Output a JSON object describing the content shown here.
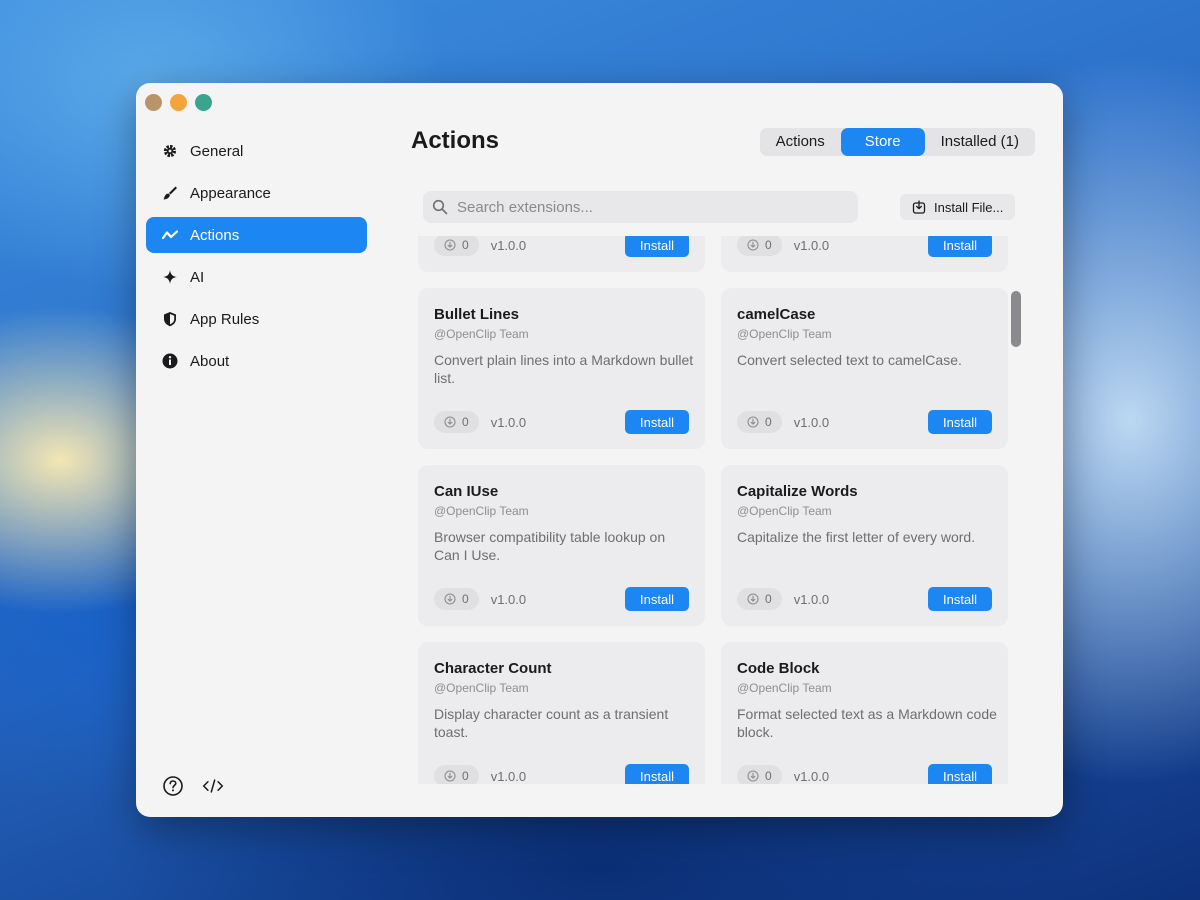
{
  "window": {
    "title": "Actions"
  },
  "sidebar": {
    "items": [
      {
        "label": "General",
        "icon": "gear-icon",
        "active": false
      },
      {
        "label": "Appearance",
        "icon": "brush-icon",
        "active": false
      },
      {
        "label": "Actions",
        "icon": "wave-icon",
        "active": true
      },
      {
        "label": "AI",
        "icon": "sparkle-icon",
        "active": false
      },
      {
        "label": "App Rules",
        "icon": "shield-icon",
        "active": false
      },
      {
        "label": "About",
        "icon": "info-icon",
        "active": false
      }
    ],
    "bottom_icons": [
      "help-icon",
      "code-icon"
    ]
  },
  "tabs": [
    {
      "label": "Actions",
      "active": false
    },
    {
      "label": "Store",
      "active": true
    },
    {
      "label": "Installed (1)",
      "active": false
    }
  ],
  "search": {
    "placeholder": "Search extensions...",
    "value": ""
  },
  "install_file_label": "Install File...",
  "cards": [
    {
      "title": "",
      "author": "",
      "description": "",
      "downloads": "0",
      "version": "v1.0.0",
      "button": "Install"
    },
    {
      "title": "",
      "author": "",
      "description": "",
      "downloads": "0",
      "version": "v1.0.0",
      "button": "Install"
    },
    {
      "title": "Bullet Lines",
      "author": "@OpenClip Team",
      "description": "Convert plain lines into a Markdown bullet list.",
      "downloads": "0",
      "version": "v1.0.0",
      "button": "Install"
    },
    {
      "title": "camelCase",
      "author": "@OpenClip Team",
      "description": "Convert selected text to camelCase.",
      "downloads": "0",
      "version": "v1.0.0",
      "button": "Install"
    },
    {
      "title": "Can IUse",
      "author": "@OpenClip Team",
      "description": "Browser compatibility table lookup on Can I Use.",
      "downloads": "0",
      "version": "v1.0.0",
      "button": "Install"
    },
    {
      "title": "Capitalize Words",
      "author": "@OpenClip Team",
      "description": "Capitalize the first letter of every word.",
      "downloads": "0",
      "version": "v1.0.0",
      "button": "Install"
    },
    {
      "title": "Character Count",
      "author": "@OpenClip Team",
      "description": "Display character count as a transient toast.",
      "downloads": "0",
      "version": "v1.0.0",
      "button": "Install"
    },
    {
      "title": "Code Block",
      "author": "@OpenClip Team",
      "description": "Format selected text as a Markdown code block.",
      "downloads": "0",
      "version": "v1.0.0",
      "button": "Install"
    }
  ],
  "colors": {
    "accent": "#1c86f2",
    "window_bg": "#f4f4f5",
    "card_bg": "#ececee"
  }
}
